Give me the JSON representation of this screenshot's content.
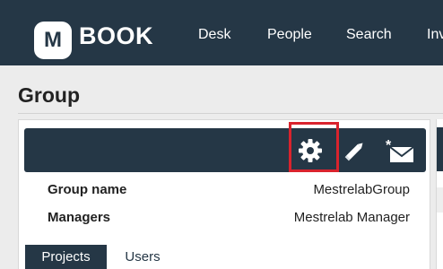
{
  "app": {
    "logo_letter": "M",
    "logo_text": "BOOK"
  },
  "nav": {
    "items": [
      "Desk",
      "People",
      "Search",
      "Inv"
    ]
  },
  "page": {
    "title": "Group"
  },
  "panel": {
    "toolbar_icons": [
      "gear-icon",
      "pencil-icon",
      "new-message-icon"
    ],
    "highlighted_icon": "gear-icon",
    "fields": [
      {
        "label": "Group name",
        "value": "MestrelabGroup"
      },
      {
        "label": "Managers",
        "value": "Mestrelab Manager"
      }
    ],
    "tabs": [
      {
        "label": "Projects",
        "active": true
      },
      {
        "label": "Users",
        "active": false
      }
    ]
  },
  "colors": {
    "header_bg": "#253746",
    "highlight": "#d9232d",
    "page_bg": "#ececec"
  }
}
